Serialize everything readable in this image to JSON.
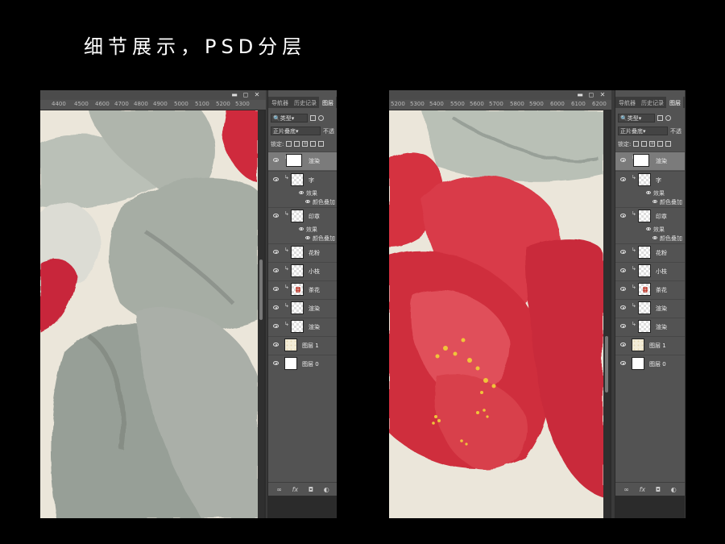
{
  "title": "细节展示，PSD分层",
  "window_buttons": [
    "▬",
    "◻",
    "✕"
  ],
  "left_ruler": [
    "4400",
    "4500",
    "4600",
    "4700",
    "4800",
    "4900",
    "5000",
    "5100",
    "5200",
    "5300"
  ],
  "right_ruler": [
    "5200",
    "5300",
    "5400",
    "5500",
    "5600",
    "5700",
    "5800",
    "5900",
    "6000",
    "6100",
    "6200"
  ],
  "panel": {
    "tabs": [
      "导航器",
      "历史记录",
      "图层"
    ],
    "kind_filter": "类型",
    "blend_mode": "正片叠底",
    "opacity_label": "不透",
    "lock_label": "锁定:",
    "layers": [
      {
        "name": "渲染",
        "thumb": "white",
        "active": true,
        "clip": true
      },
      {
        "name": "字",
        "thumb": "checker",
        "clip": true,
        "effects": [
          "效果",
          "颜色叠加"
        ]
      },
      {
        "name": "印章",
        "thumb": "checker",
        "clip": true,
        "effects": [
          "效果",
          "颜色叠加"
        ]
      },
      {
        "name": "花粉",
        "thumb": "checker",
        "clip": true
      },
      {
        "name": "小枝",
        "thumb": "checker",
        "clip": true
      },
      {
        "name": "茶花",
        "thumb": "flower",
        "clip": true
      },
      {
        "name": "渲染",
        "thumb": "checker",
        "clip": true
      },
      {
        "name": "渲染",
        "thumb": "checker",
        "clip": true
      },
      {
        "name": "图层 1",
        "thumb": "cream",
        "clip": false
      },
      {
        "name": "图层 0",
        "thumb": "white",
        "clip": false
      }
    ],
    "bottom_icons": [
      "link-icon",
      "fx-icon",
      "mask-icon",
      "adjustment-icon"
    ],
    "fx_label": "fx"
  }
}
